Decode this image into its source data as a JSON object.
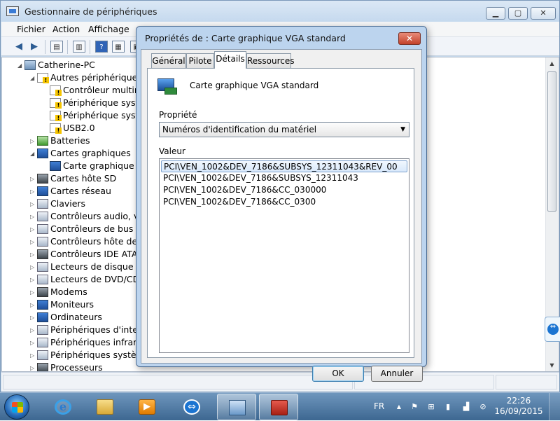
{
  "main_window": {
    "title": "Gestionnaire de périphériques",
    "menu": [
      "Fichier",
      "Action",
      "Affichage"
    ],
    "caption_buttons": {
      "minimize": "▁",
      "maximize": "▢",
      "close": "✕"
    },
    "tree": {
      "root": "Catherine-PC",
      "items": [
        "Autres périphériques",
        "Contrôleur multim",
        "Périphérique systé",
        "Périphérique systè",
        "USB2.0",
        "Batteries",
        "Cartes graphiques",
        "Carte graphique VG",
        "Cartes hôte SD",
        "Cartes réseau",
        "Claviers",
        "Contrôleurs audio, vid",
        "Contrôleurs de bus US",
        "Contrôleurs hôte de bu",
        "Contrôleurs IDE ATA/A",
        "Lecteurs de disque",
        "Lecteurs de DVD/CD-R",
        "Modems",
        "Moniteurs",
        "Ordinateurs",
        "Périphériques d'interfa",
        "Périphériques infrarou",
        "Périphériques système",
        "Processeurs"
      ]
    }
  },
  "dialog": {
    "title": "Propriétés de : Carte graphique VGA standard",
    "tabs": [
      "Général",
      "Pilote",
      "Détails",
      "Ressources"
    ],
    "active_tab": "Détails",
    "device_name": "Carte graphique VGA standard",
    "property_label": "Propriété",
    "property_selected": "Numéros d'identification du matériel",
    "value_label": "Valeur",
    "values": [
      "PCI\\VEN_1002&DEV_7186&SUBSYS_12311043&REV_00",
      "PCI\\VEN_1002&DEV_7186&SUBSYS_12311043",
      "PCI\\VEN_1002&DEV_7186&CC_030000",
      "PCI\\VEN_1002&DEV_7186&CC_0300"
    ],
    "ok_label": "OK",
    "cancel_label": "Annuler",
    "close_glyph": "✕"
  },
  "taskbar": {
    "language": "FR",
    "time": "22:26",
    "date": "16/09/2015"
  }
}
